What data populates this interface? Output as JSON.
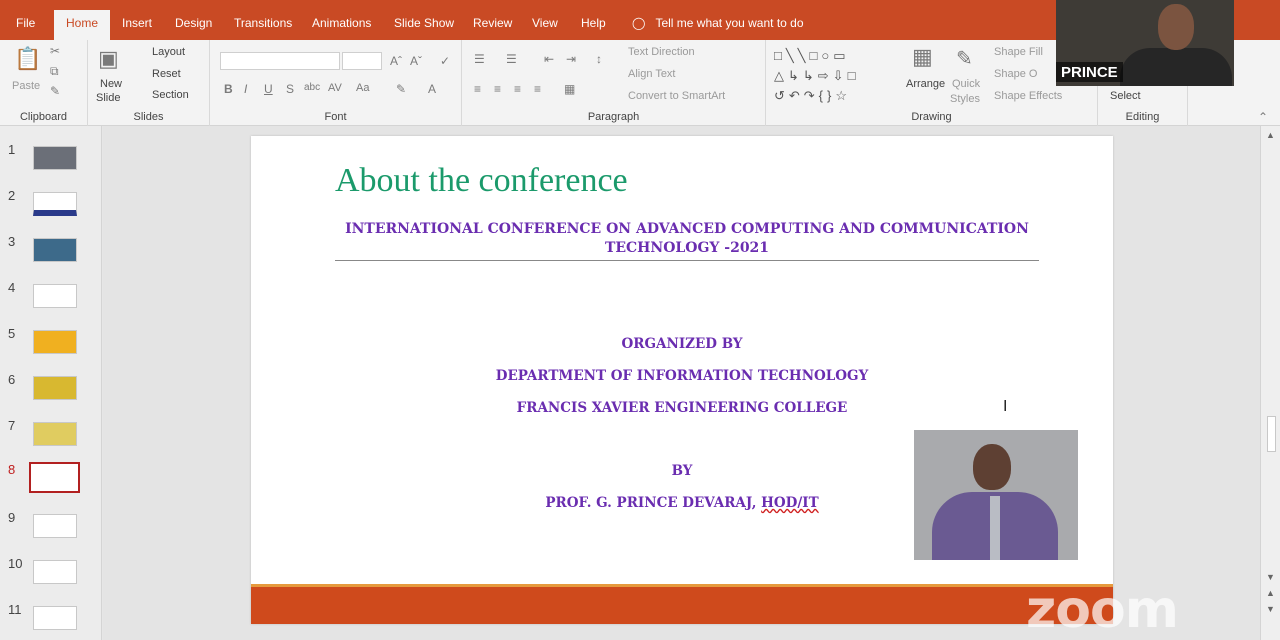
{
  "ribbon_tabs": [
    "File",
    "Home",
    "Insert",
    "Design",
    "Transitions",
    "Animations",
    "Slide Show",
    "Review",
    "View",
    "Help"
  ],
  "tell_me": "Tell me what you want to do",
  "clipboard": {
    "paste": "Paste",
    "label": "Clipboard"
  },
  "slides_group": {
    "new_slide_1": "New",
    "new_slide_2": "Slide",
    "layout": "Layout",
    "reset": "Reset",
    "section": "Section",
    "label": "Slides"
  },
  "font_group": {
    "label": "Font"
  },
  "paragraph_group": {
    "text_direction": "Text Direction",
    "align_text": "Align Text",
    "convert_smartart": "Convert to SmartArt",
    "label": "Paragraph"
  },
  "drawing_group": {
    "arrange": "Arrange",
    "quick_styles_1": "Quick",
    "quick_styles_2": "Styles",
    "shape_fill": "Shape Fill",
    "shape_outline": "Shape O",
    "shape_effects": "Shape Effects",
    "label": "Drawing"
  },
  "editing_group": {
    "select": "Select",
    "label": "Editing"
  },
  "thumbnails": [
    "1",
    "2",
    "3",
    "4",
    "5",
    "6",
    "7",
    "8",
    "9",
    "10",
    "11"
  ],
  "active_slide": "8",
  "slide": {
    "title": "About the conference",
    "subtitle_line1": "INTERNATIONAL CONFERENCE ON ADVANCED COMPUTING AND COMMUNICATION",
    "subtitle_line2": "TECHNOLOGY -2021",
    "organized_by": "ORGANIZED BY",
    "department": "DEPARTMENT OF INFORMATION TECHNOLOGY",
    "college": "FRANCIS XAVIER ENGINEERING COLLEGE",
    "by": "BY",
    "presenter": "PROF. G. PRINCE DEVARAJ, ",
    "presenter_suffix": "HOD/IT"
  },
  "participant_name": "PRINCE",
  "watermark": "zoom",
  "colors": {
    "accent": "#c94a24",
    "title_green": "#1b9a6b",
    "text_purple": "#6a2db0",
    "footer_orange": "#cf4a1c"
  }
}
